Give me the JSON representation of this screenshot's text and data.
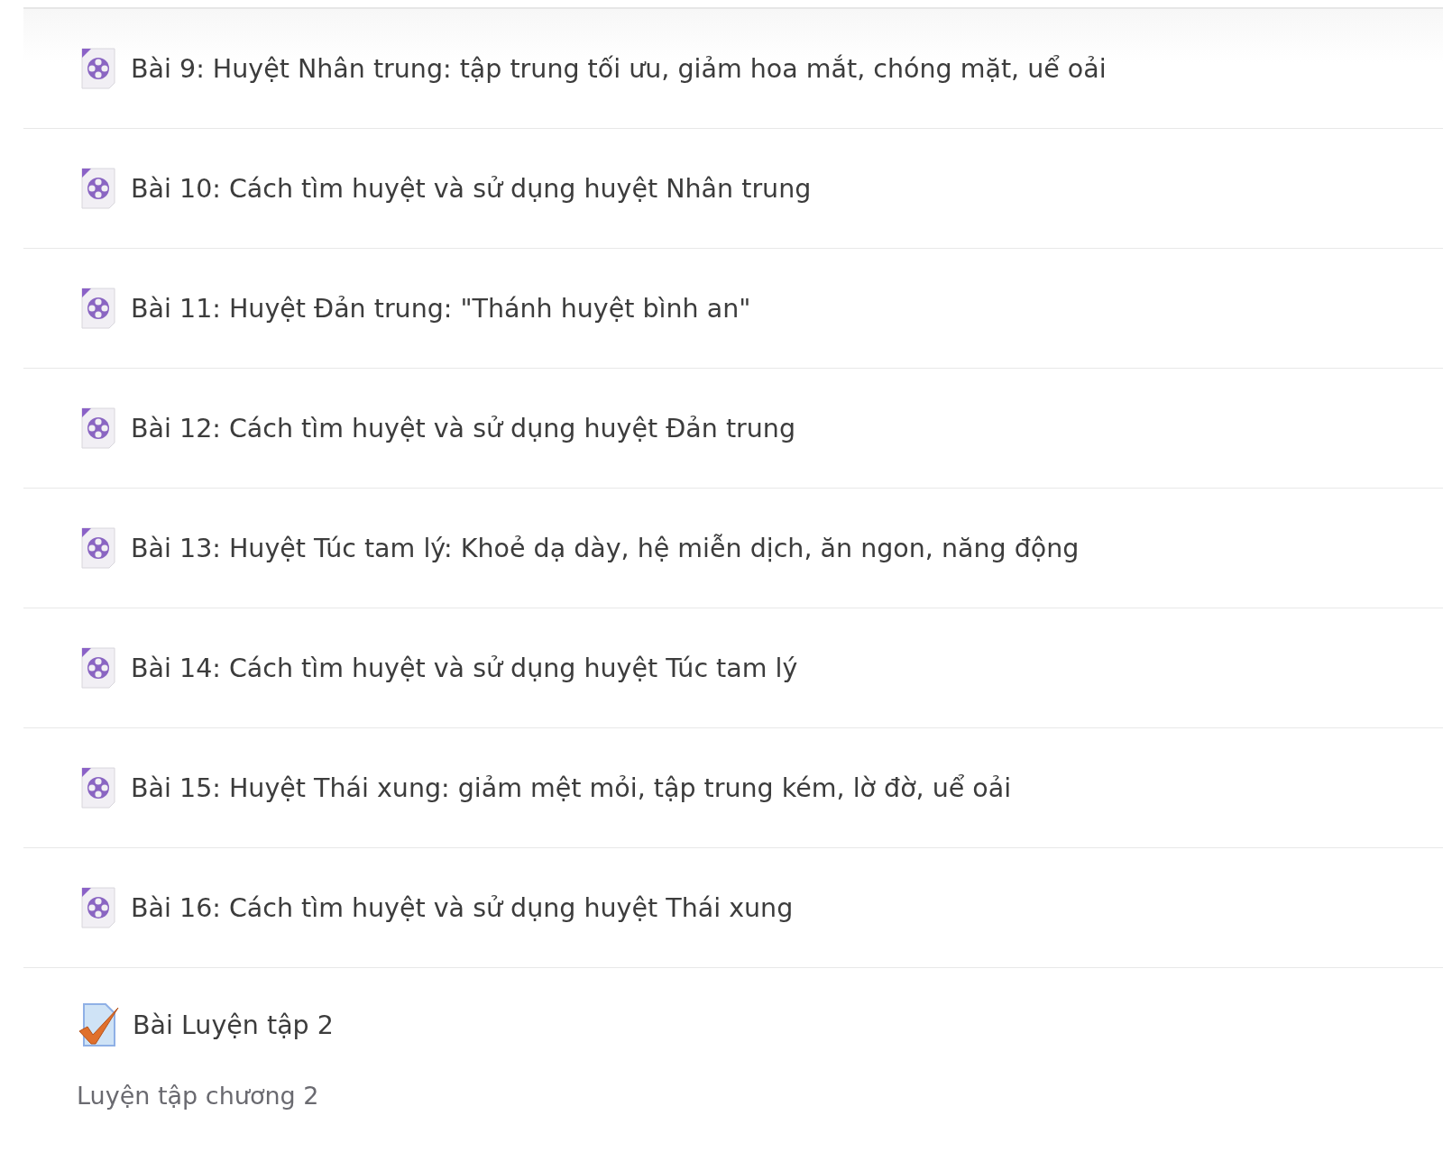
{
  "activities": [
    {
      "kind": "video",
      "title": "Bài 9: Huyệt Nhân trung: tập trung tối ưu, giảm hoa mắt, chóng mặt, uể oải"
    },
    {
      "kind": "video",
      "title": "Bài 10: Cách tìm huyệt và sử dụng huyệt Nhân trung"
    },
    {
      "kind": "video",
      "title": "Bài 11: Huyệt Đản trung: \"Thánh huyệt bình an\""
    },
    {
      "kind": "video",
      "title": "Bài 12: Cách tìm huyệt và sử dụng huyệt Đản trung"
    },
    {
      "kind": "video",
      "title": "Bài 13: Huyệt Túc tam lý: Khoẻ dạ dày, hệ miễn dịch, ăn ngon, năng động"
    },
    {
      "kind": "video",
      "title": "Bài 14: Cách tìm huyệt và sử dụng huyệt Túc tam lý"
    },
    {
      "kind": "video",
      "title": "Bài 15: Huyệt Thái xung: giảm mệt mỏi, tập trung kém, lờ đờ, uể oải"
    },
    {
      "kind": "video",
      "title": "Bài 16: Cách tìm huyệt và sử dụng huyệt Thái xung"
    },
    {
      "kind": "quiz",
      "title": "Bài Luyện tập 2",
      "description": "Luyện tập chương 2"
    }
  ]
}
